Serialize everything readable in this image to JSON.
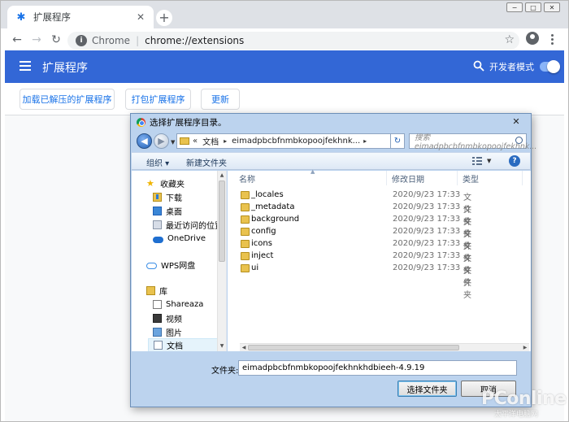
{
  "browser": {
    "tab": {
      "title": "扩展程序",
      "close_glyph": "✕"
    },
    "new_tab_glyph": "+",
    "omnibox": {
      "scheme_label": "Chrome",
      "url": "chrome://extensions"
    },
    "window_controls": [
      "−",
      "□",
      "✕"
    ]
  },
  "extensions": {
    "header_title": "扩展程序",
    "developer_mode_label": "开发者模式",
    "developer_mode_on": true,
    "buttons": {
      "load_unpacked": "加载已解压的扩展程序",
      "pack": "打包扩展程序",
      "update": "更新"
    },
    "colors": {
      "header_bg": "#3367d6",
      "button_text": "#1a73e8"
    }
  },
  "dialog": {
    "title": "选择扩展程序目录。",
    "close_glyph": "✕",
    "address": {
      "prefix": "«",
      "crumb1": "文档",
      "crumb2": "eimadpbcbfnmbkopoojfekhnk...",
      "arrow": "▸"
    },
    "search_placeholder": "搜索 eimadpbcbfnmbkopoojfekhnk...",
    "toolbar": {
      "organize": "组织 ▾",
      "new_folder": "新建文件夹"
    },
    "nav": {
      "favorites": "收藏夹",
      "downloads": "下载",
      "desktop": "桌面",
      "recent": "最近访问的位置",
      "onedrive": "OneDrive",
      "wps": "WPS网盘",
      "library": "库",
      "shareaza": "Shareaza",
      "video": "视频",
      "pictures": "图片",
      "documents": "文档"
    },
    "columns": {
      "name": "名称",
      "modified": "修改日期",
      "type": "类型"
    },
    "files": [
      {
        "name": "_locales",
        "date": "2020/9/23 17:33",
        "type": "文件夹"
      },
      {
        "name": "_metadata",
        "date": "2020/9/23 17:33",
        "type": "文件夹"
      },
      {
        "name": "background",
        "date": "2020/9/23 17:33",
        "type": "文件夹"
      },
      {
        "name": "config",
        "date": "2020/9/23 17:33",
        "type": "文件夹"
      },
      {
        "name": "icons",
        "date": "2020/9/23 17:33",
        "type": "文件夹"
      },
      {
        "name": "inject",
        "date": "2020/9/23 17:33",
        "type": "文件夹"
      },
      {
        "name": "ui",
        "date": "2020/9/23 17:33",
        "type": "文件夹"
      }
    ],
    "folder_label": "文件夹:",
    "folder_value": "eimadpbcbfnmbkopoojfekhnkhdbieeh-4.9.19",
    "select_button": "选择文件夹",
    "cancel_button": "取消"
  },
  "watermark": {
    "brand": "PConline",
    "sub": "太平洋电脑网"
  }
}
